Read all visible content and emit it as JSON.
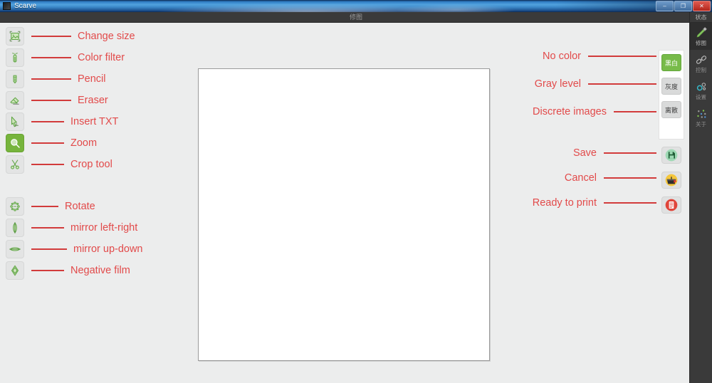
{
  "window": {
    "title": "Scarve",
    "app_icon": "app-icon",
    "buttons": {
      "minimize": "–",
      "maximize": "❐",
      "close": "✕"
    }
  },
  "secondary_bar": {
    "label": "修图"
  },
  "sidebar": {
    "header": "状态",
    "items": [
      {
        "label": "修图",
        "icon": "pencil-icon",
        "active": true
      },
      {
        "label": "控制",
        "icon": "link-icon",
        "active": false
      },
      {
        "label": "设置",
        "icon": "gears-icon",
        "active": false
      },
      {
        "label": "关于",
        "icon": "dots-icon",
        "active": false
      }
    ]
  },
  "left_tools": {
    "group_one": [
      {
        "label": "Change size",
        "icon": "change-size-icon",
        "leader": 56,
        "solid": false
      },
      {
        "label": "Color filter",
        "icon": "color-filter-icon",
        "leader": 56,
        "solid": false
      },
      {
        "label": "Pencil",
        "icon": "pencil-tool-icon",
        "leader": 56,
        "solid": false
      },
      {
        "label": "Eraser",
        "icon": "eraser-icon",
        "leader": 56,
        "solid": false
      },
      {
        "label": "Insert TXT",
        "icon": "insert-text-icon",
        "leader": 46,
        "solid": false
      },
      {
        "label": "Zoom",
        "icon": "zoom-icon",
        "leader": 46,
        "solid": true
      },
      {
        "label": "Crop tool",
        "icon": "crop-tool-icon",
        "leader": 46,
        "solid": false
      }
    ],
    "group_two": [
      {
        "label": "Rotate",
        "icon": "rotate-icon",
        "leader": 38,
        "solid": false
      },
      {
        "label": "mirror left-right",
        "icon": "mirror-horizontal-icon",
        "leader": 46,
        "solid": false
      },
      {
        "label": "mirror up-down",
        "icon": "mirror-vertical-icon",
        "leader": 50,
        "solid": false
      },
      {
        "label": "Negative film",
        "icon": "negative-film-icon",
        "leader": 46,
        "solid": false
      }
    ]
  },
  "mode_panel": {
    "buttons": [
      {
        "label": "黑白",
        "annotation": "No color",
        "active": true,
        "leader": 96
      },
      {
        "label": "灰度",
        "annotation": "Gray level",
        "active": false,
        "leader": 96
      },
      {
        "label": "离散",
        "annotation": "Discrete images",
        "active": false,
        "leader": 60
      }
    ]
  },
  "action_panel": {
    "buttons": [
      {
        "annotation": "Save",
        "icon": "save-icon",
        "leader": 74
      },
      {
        "annotation": "Cancel",
        "icon": "cancel-icon",
        "leader": 74
      },
      {
        "annotation": "Ready to print",
        "icon": "print-icon",
        "leader": 74
      }
    ]
  },
  "canvas": {
    "name": "image-canvas",
    "fill_color": "#ffffff",
    "border_color": "#9b9b9b"
  },
  "colors": {
    "annotation_red": "#e24a4a",
    "leader_red": "#d23b3b",
    "accent_green": "#78bb4a",
    "workspace_bg": "#eceded",
    "sidebar_bg": "#3a3a3a"
  }
}
